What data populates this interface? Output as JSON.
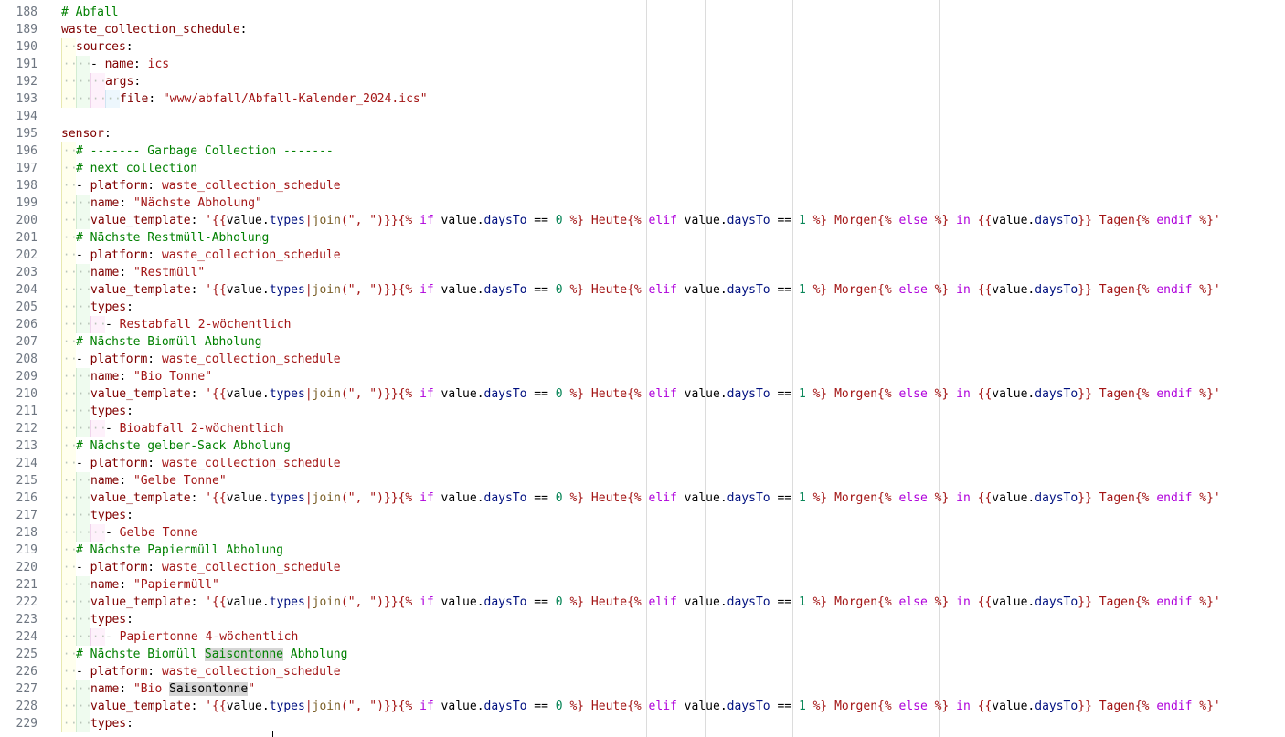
{
  "editor": {
    "first_line_number": 188,
    "selection_highlight_word": "Saisontonne"
  },
  "lines": [
    {
      "n": "188",
      "indent": 0,
      "tokens": [
        [
          "comment",
          "# Abfall"
        ]
      ]
    },
    {
      "n": "189",
      "indent": 0,
      "tokens": [
        [
          "key",
          "waste_collection_schedule"
        ],
        [
          "plain",
          ":"
        ]
      ]
    },
    {
      "n": "190",
      "indent": 1,
      "tokens": [
        [
          "key",
          "sources"
        ],
        [
          "plain",
          ":"
        ]
      ]
    },
    {
      "n": "191",
      "indent": 2,
      "tokens": [
        [
          "plain",
          "- "
        ],
        [
          "key",
          "name"
        ],
        [
          "plain",
          ": "
        ],
        [
          "val",
          "ics"
        ]
      ]
    },
    {
      "n": "192",
      "indent": 3,
      "tokens": [
        [
          "key",
          "args"
        ],
        [
          "plain",
          ":"
        ]
      ]
    },
    {
      "n": "193",
      "indent": 4,
      "tokens": [
        [
          "key",
          "file"
        ],
        [
          "plain",
          ": "
        ],
        [
          "str",
          "\"www/abfall/Abfall-Kalender_2024.ics\""
        ]
      ]
    },
    {
      "n": "194",
      "indent": 0,
      "tokens": []
    },
    {
      "n": "195",
      "indent": 0,
      "tokens": [
        [
          "key",
          "sensor"
        ],
        [
          "plain",
          ":"
        ]
      ]
    },
    {
      "n": "196",
      "indent": 1,
      "tokens": [
        [
          "comment",
          "# ------- Garbage Collection -------"
        ]
      ]
    },
    {
      "n": "197",
      "indent": 1,
      "tokens": [
        [
          "comment",
          "# next collection"
        ]
      ]
    },
    {
      "n": "198",
      "indent": 1,
      "tokens": [
        [
          "plain",
          "- "
        ],
        [
          "key",
          "platform"
        ],
        [
          "plain",
          ": "
        ],
        [
          "val",
          "waste_collection_schedule"
        ]
      ]
    },
    {
      "n": "199",
      "indent": 2,
      "tokens": [
        [
          "key",
          "name"
        ],
        [
          "plain",
          ": "
        ],
        [
          "str",
          "\"Nächste Abholung\""
        ]
      ]
    },
    {
      "n": "200",
      "indent": 2,
      "template": true
    },
    {
      "n": "201",
      "indent": 1,
      "tokens": [
        [
          "comment",
          "# Nächste Restmüll-Abholung"
        ]
      ]
    },
    {
      "n": "202",
      "indent": 1,
      "tokens": [
        [
          "plain",
          "- "
        ],
        [
          "key",
          "platform"
        ],
        [
          "plain",
          ": "
        ],
        [
          "val",
          "waste_collection_schedule"
        ]
      ]
    },
    {
      "n": "203",
      "indent": 2,
      "tokens": [
        [
          "key",
          "name"
        ],
        [
          "plain",
          ": "
        ],
        [
          "str",
          "\"Restmüll\""
        ]
      ]
    },
    {
      "n": "204",
      "indent": 2,
      "template": true
    },
    {
      "n": "205",
      "indent": 2,
      "tokens": [
        [
          "key",
          "types"
        ],
        [
          "plain",
          ":"
        ]
      ]
    },
    {
      "n": "206",
      "indent": 3,
      "tokens": [
        [
          "plain",
          "- "
        ],
        [
          "val",
          "Restabfall 2-wöchentlich"
        ]
      ]
    },
    {
      "n": "207",
      "indent": 1,
      "tokens": [
        [
          "comment",
          "# Nächste Biomüll Abholung"
        ]
      ]
    },
    {
      "n": "208",
      "indent": 1,
      "tokens": [
        [
          "plain",
          "- "
        ],
        [
          "key",
          "platform"
        ],
        [
          "plain",
          ": "
        ],
        [
          "val",
          "waste_collection_schedule"
        ]
      ]
    },
    {
      "n": "209",
      "indent": 2,
      "tokens": [
        [
          "key",
          "name"
        ],
        [
          "plain",
          ": "
        ],
        [
          "str",
          "\"Bio Tonne\""
        ]
      ]
    },
    {
      "n": "210",
      "indent": 2,
      "template": true
    },
    {
      "n": "211",
      "indent": 2,
      "tokens": [
        [
          "key",
          "types"
        ],
        [
          "plain",
          ":"
        ]
      ]
    },
    {
      "n": "212",
      "indent": 3,
      "tokens": [
        [
          "plain",
          "- "
        ],
        [
          "val",
          "Bioabfall 2-wöchentlich"
        ]
      ]
    },
    {
      "n": "213",
      "indent": 1,
      "tokens": [
        [
          "comment",
          "# Nächste gelber-Sack Abholung"
        ]
      ]
    },
    {
      "n": "214",
      "indent": 1,
      "tokens": [
        [
          "plain",
          "- "
        ],
        [
          "key",
          "platform"
        ],
        [
          "plain",
          ": "
        ],
        [
          "val",
          "waste_collection_schedule"
        ]
      ]
    },
    {
      "n": "215",
      "indent": 2,
      "tokens": [
        [
          "key",
          "name"
        ],
        [
          "plain",
          ": "
        ],
        [
          "str",
          "\"Gelbe Tonne\""
        ]
      ]
    },
    {
      "n": "216",
      "indent": 2,
      "template": true
    },
    {
      "n": "217",
      "indent": 2,
      "tokens": [
        [
          "key",
          "types"
        ],
        [
          "plain",
          ":"
        ]
      ]
    },
    {
      "n": "218",
      "indent": 3,
      "tokens": [
        [
          "plain",
          "- "
        ],
        [
          "val",
          "Gelbe Tonne"
        ]
      ]
    },
    {
      "n": "219",
      "indent": 1,
      "tokens": [
        [
          "comment",
          "# Nächste Papiermüll Abholung"
        ]
      ]
    },
    {
      "n": "220",
      "indent": 1,
      "tokens": [
        [
          "plain",
          "- "
        ],
        [
          "key",
          "platform"
        ],
        [
          "plain",
          ": "
        ],
        [
          "val",
          "waste_collection_schedule"
        ]
      ]
    },
    {
      "n": "221",
      "indent": 2,
      "tokens": [
        [
          "key",
          "name"
        ],
        [
          "plain",
          ": "
        ],
        [
          "str",
          "\"Papiermüll\""
        ]
      ]
    },
    {
      "n": "222",
      "indent": 2,
      "template": true
    },
    {
      "n": "223",
      "indent": 2,
      "tokens": [
        [
          "key",
          "types"
        ],
        [
          "plain",
          ":"
        ]
      ]
    },
    {
      "n": "224",
      "indent": 3,
      "tokens": [
        [
          "plain",
          "- "
        ],
        [
          "val",
          "Papiertonne 4-wöchentlich"
        ]
      ]
    },
    {
      "n": "225",
      "indent": 1,
      "tokens": [
        [
          "comment",
          "# Nächste Biomüll "
        ],
        [
          "hl-green",
          "Saisontonne"
        ],
        [
          "comment",
          " Abholung"
        ]
      ]
    },
    {
      "n": "226",
      "indent": 1,
      "tokens": [
        [
          "plain",
          "- "
        ],
        [
          "key",
          "platform"
        ],
        [
          "plain",
          ": "
        ],
        [
          "val",
          "waste_collection_schedule"
        ]
      ]
    },
    {
      "n": "227",
      "indent": 2,
      "tokens": [
        [
          "key",
          "name"
        ],
        [
          "plain",
          ": "
        ],
        [
          "str",
          "\"Bio "
        ],
        [
          "hl",
          "Saisontonne"
        ],
        [
          "str",
          "\""
        ]
      ]
    },
    {
      "n": "228",
      "indent": 2,
      "template": true
    },
    {
      "n": "229",
      "indent": 2,
      "tokens": [
        [
          "key",
          "types"
        ],
        [
          "plain",
          ":"
        ]
      ]
    }
  ],
  "value_template_tokens": [
    [
      "key",
      "value_template"
    ],
    [
      "plain",
      ": "
    ],
    [
      "str",
      "'{{"
    ],
    [
      "plain",
      "value"
    ],
    [
      "plain",
      "."
    ],
    [
      "prop",
      "types"
    ],
    [
      "str",
      "|"
    ],
    [
      "fn",
      "join"
    ],
    [
      "str",
      "(\", \")}}{% "
    ],
    [
      "kw",
      "if"
    ],
    [
      "plain",
      " value"
    ],
    [
      "plain",
      "."
    ],
    [
      "prop",
      "daysTo"
    ],
    [
      "plain",
      " == "
    ],
    [
      "num",
      "0"
    ],
    [
      "str",
      " %} Heute{% "
    ],
    [
      "kw",
      "elif"
    ],
    [
      "plain",
      " value"
    ],
    [
      "plain",
      "."
    ],
    [
      "prop",
      "daysTo"
    ],
    [
      "plain",
      " == "
    ],
    [
      "num",
      "1"
    ],
    [
      "str",
      " %} Morgen{% "
    ],
    [
      "kw",
      "else"
    ],
    [
      "str",
      " %} "
    ],
    [
      "kw",
      "in"
    ],
    [
      "str",
      " {{"
    ],
    [
      "plain",
      "value"
    ],
    [
      "plain",
      "."
    ],
    [
      "prop",
      "daysTo"
    ],
    [
      "str",
      "}} Tagen{% "
    ],
    [
      "kw",
      "endif"
    ],
    [
      "str",
      " %}'"
    ]
  ]
}
